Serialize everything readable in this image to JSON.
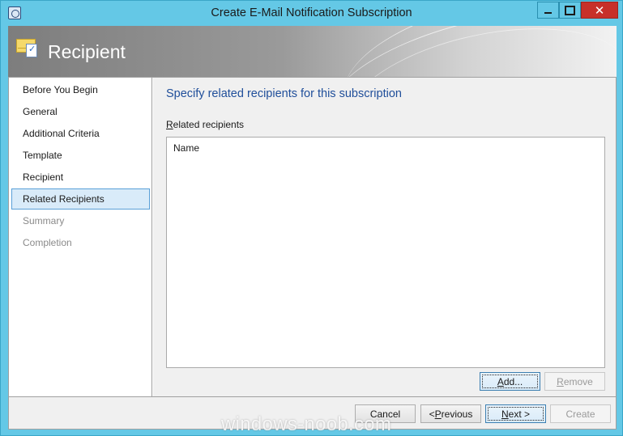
{
  "window": {
    "title": "Create E-Mail Notification Subscription",
    "close_glyph": "✕",
    "colors": {
      "chrome": "#64c8e6",
      "close": "#c7302a",
      "heading": "#1f4e9a"
    }
  },
  "banner": {
    "title": "Recipient",
    "icon": "envelope-checklist-icon"
  },
  "nav": {
    "items": [
      {
        "label": "Before You Begin",
        "state": "normal"
      },
      {
        "label": "General",
        "state": "normal"
      },
      {
        "label": "Additional Criteria",
        "state": "normal"
      },
      {
        "label": "Template",
        "state": "normal"
      },
      {
        "label": "Recipient",
        "state": "normal"
      },
      {
        "label": "Related Recipients",
        "state": "active"
      },
      {
        "label": "Summary",
        "state": "disabled"
      },
      {
        "label": "Completion",
        "state": "disabled"
      }
    ]
  },
  "main": {
    "heading": "Specify related recipients for this subscription",
    "list_label_first": "R",
    "list_label_rest": "elated recipients",
    "list_column_header": "Name",
    "add_first": "A",
    "add_rest": "dd...",
    "remove_first": "R",
    "remove_rest": "emove"
  },
  "footer": {
    "cancel": "Cancel",
    "previous_prefix": "< ",
    "previous_first": "P",
    "previous_rest": "revious",
    "next_first": "N",
    "next_rest": "ext >",
    "create": "Create"
  },
  "watermark": "windows-noob.com"
}
